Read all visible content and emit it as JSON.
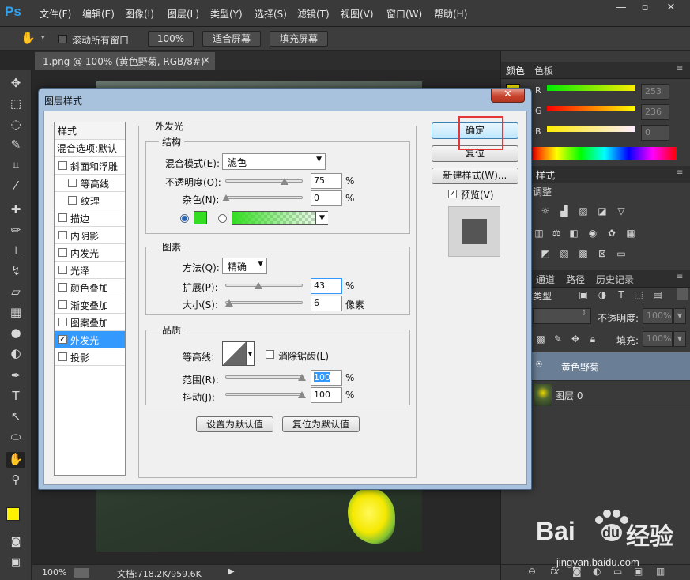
{
  "app": {
    "logo": "Ps",
    "menu": [
      "文件(F)",
      "编辑(E)",
      "图像(I)",
      "图层(L)",
      "类型(Y)",
      "选择(S)",
      "滤镜(T)",
      "视图(V)",
      "窗口(W)",
      "帮助(H)"
    ],
    "window_controls": [
      "—",
      "▫",
      "✕"
    ]
  },
  "options_bar": {
    "scroll_all_label": "滚动所有窗口",
    "zoom_100": "100%",
    "fit_screen": "适合屏幕",
    "fill_screen": "填充屏幕"
  },
  "document": {
    "tab_label": "1.png @ 100% (黄色野菊, RGB/8#) *",
    "tab_close": "×"
  },
  "status_bar": {
    "zoom": "100%",
    "doc_info": "文档:718.2K/959.6K"
  },
  "color_panel": {
    "tabs": [
      "颜色",
      "色板"
    ],
    "channels": [
      {
        "label": "R",
        "value": "253"
      },
      {
        "label": "G",
        "value": "236"
      },
      {
        "label": "B",
        "value": "0"
      }
    ]
  },
  "styles_panel": {
    "tab": "样式",
    "adjustments_label": "调整"
  },
  "layers_panel": {
    "tabs": [
      "通道",
      "路径",
      "历史记录"
    ],
    "kind_label": "类型",
    "opacity_label": "不透明度:",
    "opacity_value": "100%",
    "fill_label": "填充:",
    "fill_value": "100%",
    "layers": [
      {
        "name": "黄色野菊",
        "selected": true
      },
      {
        "name": "图层 0",
        "selected": false
      }
    ]
  },
  "dialog": {
    "title": "图层样式",
    "close": "✕",
    "styles_header": "样式",
    "blend_options": "混合选项:默认",
    "style_items": [
      {
        "label": "斜面和浮雕",
        "checked": false,
        "indent": false
      },
      {
        "label": "等高线",
        "checked": false,
        "indent": true
      },
      {
        "label": "纹理",
        "checked": false,
        "indent": true
      },
      {
        "label": "描边",
        "checked": false,
        "indent": false
      },
      {
        "label": "内阴影",
        "checked": false,
        "indent": false
      },
      {
        "label": "内发光",
        "checked": false,
        "indent": false
      },
      {
        "label": "光泽",
        "checked": false,
        "indent": false
      },
      {
        "label": "颜色叠加",
        "checked": false,
        "indent": false
      },
      {
        "label": "渐变叠加",
        "checked": false,
        "indent": false
      },
      {
        "label": "图案叠加",
        "checked": false,
        "indent": false
      },
      {
        "label": "外发光",
        "checked": true,
        "indent": false,
        "selected": true
      },
      {
        "label": "投影",
        "checked": false,
        "indent": false
      }
    ],
    "outer_glow": {
      "section_title": "外发光",
      "structure": {
        "title": "结构",
        "blend_mode_label": "混合模式(E):",
        "blend_mode_value": "滤色",
        "opacity_label": "不透明度(O):",
        "opacity_value": "75",
        "opacity_unit": "%",
        "noise_label": "杂色(N):",
        "noise_value": "0",
        "noise_unit": "%",
        "glow_color": "#33dd22"
      },
      "elements": {
        "title": "图素",
        "technique_label": "方法(Q):",
        "technique_value": "精确",
        "spread_label": "扩展(P):",
        "spread_value": "43",
        "spread_unit": "%",
        "size_label": "大小(S):",
        "size_value": "6",
        "size_unit": "像素"
      },
      "quality": {
        "title": "品质",
        "contour_label": "等高线:",
        "antialias_label": "消除锯齿(L)",
        "range_label": "范围(R):",
        "range_value": "100",
        "range_unit": "%",
        "jitter_label": "抖动(J):",
        "jitter_value": "100",
        "jitter_unit": "%"
      },
      "make_default": "设置为默认值",
      "reset_default": "复位为默认值"
    },
    "buttons": {
      "ok": "确定",
      "reset": "复位",
      "new_style": "新建样式(W)...",
      "preview": "预览(V)"
    }
  },
  "watermark": {
    "brand": "Bai",
    "brand_suffix": "du",
    "jingyan": "经验",
    "url": "jingyan.baidu.com"
  }
}
